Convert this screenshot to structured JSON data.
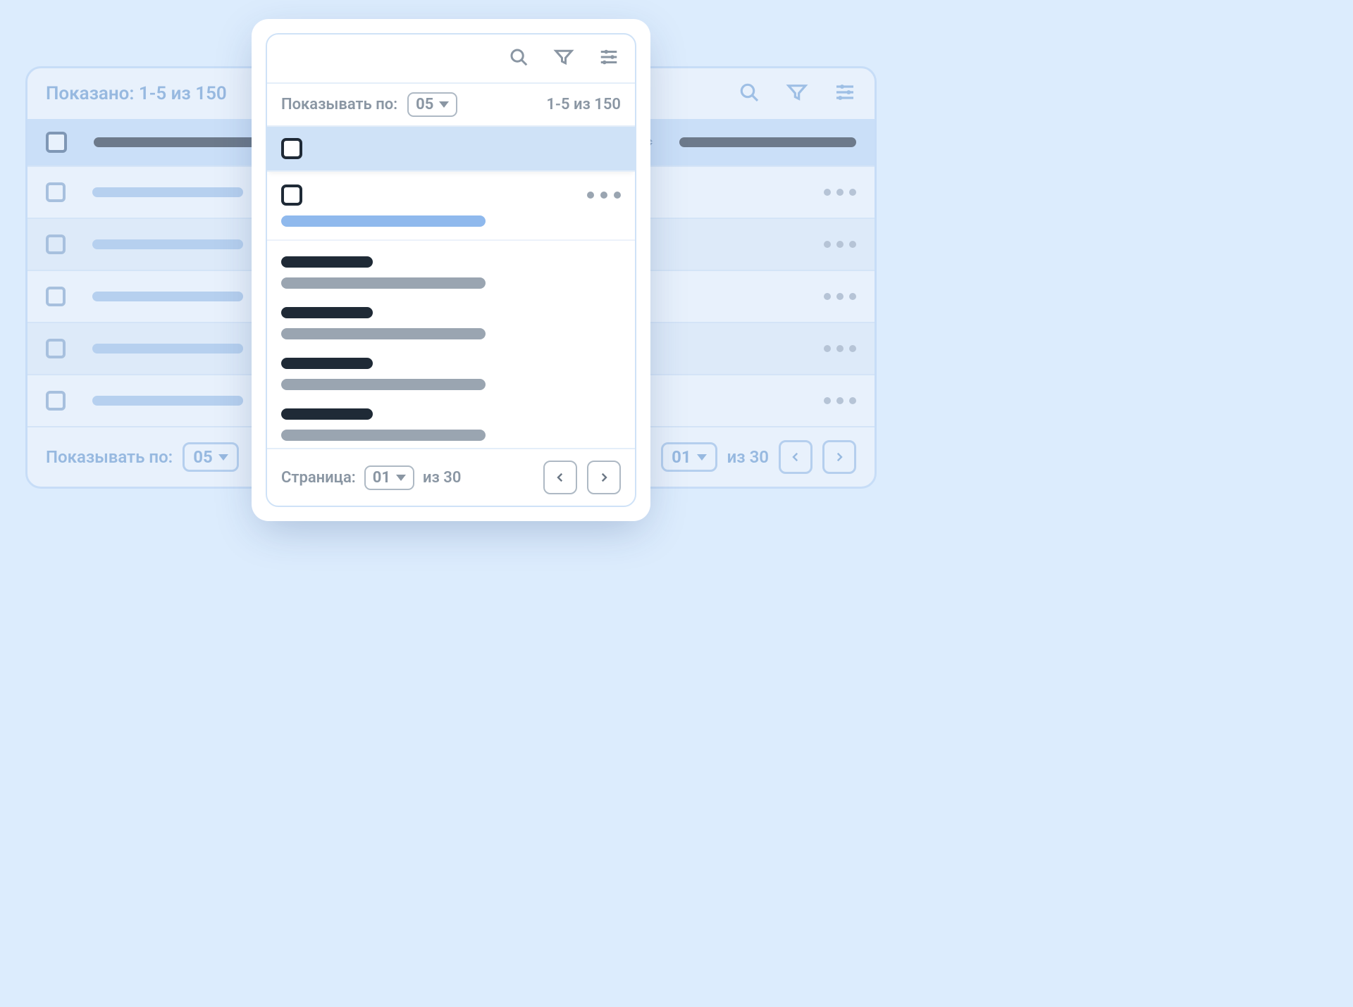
{
  "desktop": {
    "showing_label": "Показано: 1-5 из 150",
    "per_page_label": "Показывать по:",
    "per_page_value": "05",
    "page_value": "01",
    "page_of": "из 30"
  },
  "mobile": {
    "per_page_label": "Показывать по:",
    "per_page_value": "05",
    "range_text": "1-5 из 150",
    "page_label": "Страница:",
    "page_value": "01",
    "page_of": "из 30"
  }
}
